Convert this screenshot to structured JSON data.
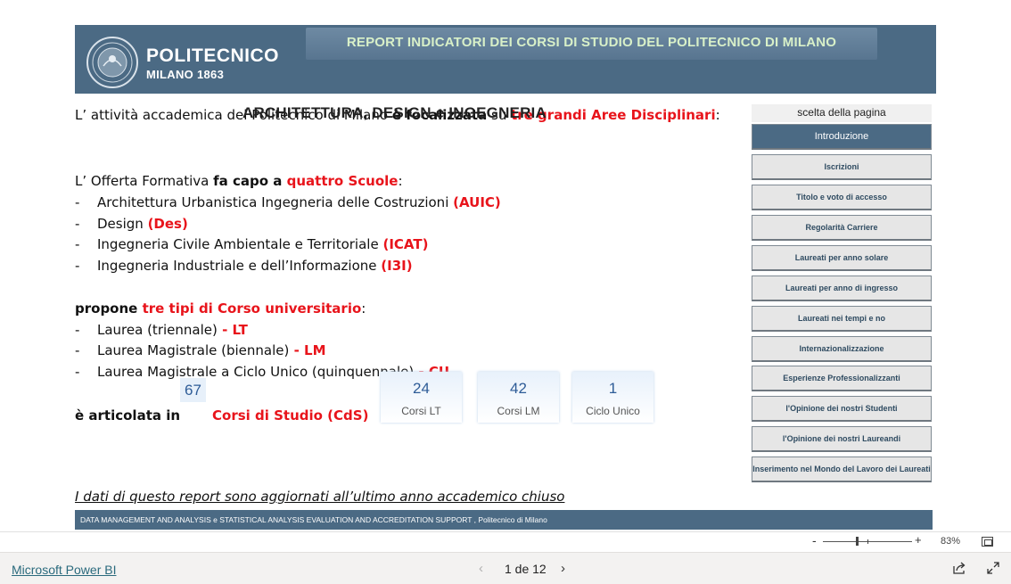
{
  "header": {
    "logo_name": "POLITECNICO",
    "logo_sub": "MILANO 1863",
    "title": "REPORT INDICATORI DEI CORSI DI STUDIO DEL POLITECNICO DI MILANO"
  },
  "intro": {
    "l1_a": "L’ attività accademica del Politecnico di Milano ",
    "l1_b": "è focalizzata",
    "l1_c": " su ",
    "l1_d": "tre grandi Aree Disciplinari",
    "l1_e": ":",
    "areas": "ARCHITETTURA,  DESIGN  e  INGEGNERIA",
    "offer_a": "L’ Offerta Formativa ",
    "offer_b": "fa capo a ",
    "offer_c": "quattro Scuole",
    "offer_d": ":"
  },
  "schools": [
    {
      "name": "Architettura Urbanistica Ingegneria delle Costruzioni",
      "code": "(AUIC)"
    },
    {
      "name": "Design",
      "code": "(Des)"
    },
    {
      "name": "Ingegneria Civile Ambientale e Territoriale",
      "code": "(ICAT)"
    },
    {
      "name": "Ingegneria Industriale e dell’Informazione",
      "code": "(I3I)"
    }
  ],
  "courses_intro": {
    "a": "propone ",
    "b": "tre tipi di Corso universitario",
    "c": ":"
  },
  "course_types": [
    {
      "name": "Laurea (triennale)",
      "code": " - LT"
    },
    {
      "name": "Laurea Magistrale (biennale)",
      "code": " - LM"
    },
    {
      "name": "Laurea Magistrale a Ciclo Unico (quinquennale)",
      "code": " - CU"
    }
  ],
  "articulation": {
    "prefix": "è articolata in ",
    "count": "67",
    "suffix": "Corsi di Studio (CdS)"
  },
  "cards": [
    {
      "value": "24",
      "label": "Corsi LT"
    },
    {
      "value": "42",
      "label": "Corsi LM"
    },
    {
      "value": "1",
      "label": "Ciclo Unico"
    }
  ],
  "note": "I dati di questo report sono aggiornati all’ultimo anno accademico chiuso",
  "footer": "DATA MANAGEMENT AND ANALYSIS    e    STATISTICAL ANALYSIS EVALUATION AND ACCREDITATION SUPPORT ,  Politecnico di Milano",
  "nav": {
    "heading": "scelta della pagina",
    "items": [
      "Introduzione",
      "Iscrizioni",
      "Titolo e voto di accesso",
      "Regolarità Carriere",
      "Laureati per anno solare",
      "Laureati per anno di ingresso",
      "Laureati nei tempi e no",
      "Internazionalizzazione",
      "Esperienze Professionalizzanti",
      "l'Opinione dei nostri Studenti",
      "l'Opinione dei nostri Laureandi",
      "Inserimento nel Mondo del Lavoro dei Laureati"
    ]
  },
  "zoom": {
    "minus": "-",
    "plus": "+",
    "level": "83%",
    "value_percent": 83
  },
  "bottom": {
    "brand": "Microsoft Power BI",
    "page": "1 de 12",
    "prev": "‹",
    "next": "›"
  },
  "colors": {
    "banner": "#4b6a84",
    "accent_red": "#e8141b",
    "number_blue": "#2e5c97"
  },
  "icons": [
    "seal-icon",
    "fit-page-icon",
    "share-icon",
    "expand-icon",
    "chevron-left-icon",
    "chevron-right-icon"
  ]
}
